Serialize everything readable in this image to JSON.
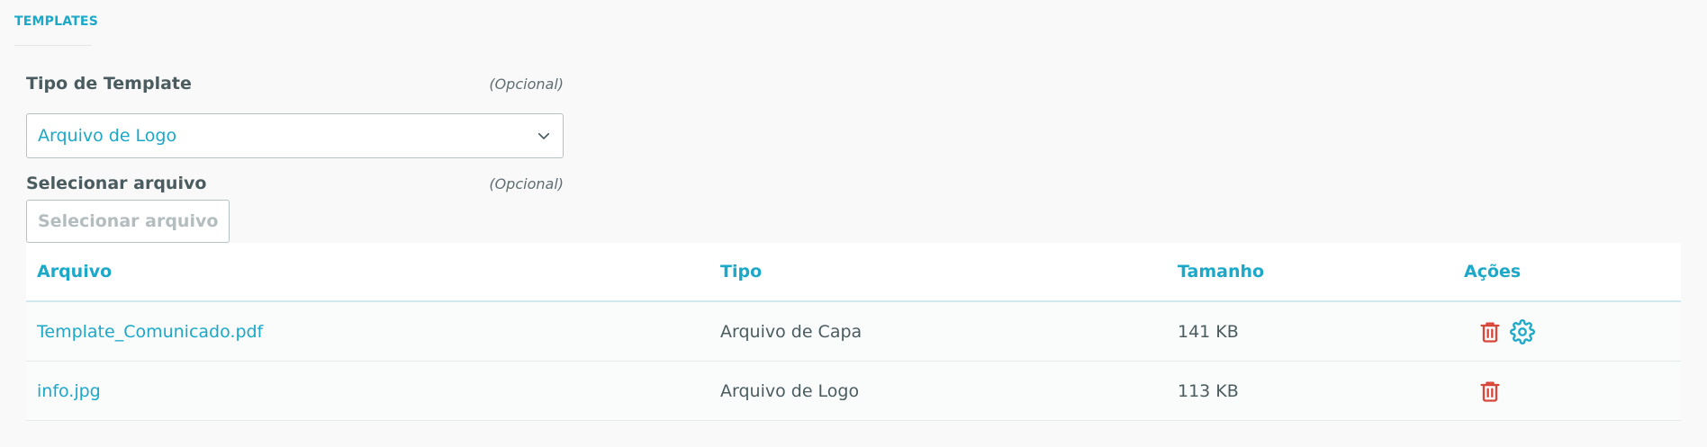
{
  "section": {
    "tab_label": "TEMPLATES"
  },
  "template_type": {
    "label": "Tipo de Template",
    "optional": "(Opcional)",
    "selected": "Arquivo de Logo"
  },
  "file_select": {
    "label": "Selecionar arquivo",
    "optional": "(Opcional)",
    "button_label": "Selecionar arquivo"
  },
  "table": {
    "headers": [
      "Arquivo",
      "Tipo",
      "Tamanho",
      "Ações"
    ],
    "rows": [
      {
        "file": "Template_Comunicado.pdf",
        "type": "Arquivo de Capa",
        "size": "141 KB",
        "actions": [
          "trash-icon",
          "gear-icon"
        ]
      },
      {
        "file": "info.jpg",
        "type": "Arquivo de Logo",
        "size": "113 KB",
        "actions": [
          "trash-icon"
        ]
      }
    ]
  },
  "colors": {
    "accent": "#1ca8c8",
    "danger": "#d9463a",
    "text": "#4a5c60",
    "background": "#f9f9f9"
  }
}
